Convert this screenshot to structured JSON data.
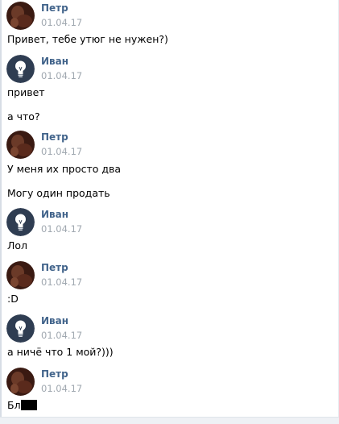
{
  "authors": {
    "petr": "Петр",
    "ivan": "Иван"
  },
  "messages": [
    {
      "author": "Петр",
      "avatar_icon": "user-photo-avatar",
      "date": "01.04.17",
      "lines": [
        "Привет, тебе утюг не нужен?)"
      ]
    },
    {
      "author": "Иван",
      "avatar_icon": "lightbulb-icon",
      "date": "01.04.17",
      "lines": [
        "привет",
        "а что?"
      ]
    },
    {
      "author": "Петр",
      "avatar_icon": "user-photo-avatar",
      "date": "01.04.17",
      "lines": [
        "У меня их просто два",
        "Могу один продать"
      ]
    },
    {
      "author": "Иван",
      "avatar_icon": "lightbulb-icon",
      "date": "01.04.17",
      "lines": [
        "Лол"
      ]
    },
    {
      "author": "Петр",
      "avatar_icon": "user-photo-avatar",
      "date": "01.04.17",
      "lines": [
        ":D"
      ]
    },
    {
      "author": "Иван",
      "avatar_icon": "lightbulb-icon",
      "date": "01.04.17",
      "lines": [
        "а ничё что 1 мой?)))"
      ]
    },
    {
      "author": "Петр",
      "avatar_icon": "user-photo-avatar",
      "date": "01.04.17",
      "lines": [
        "Бл"
      ]
    }
  ],
  "colors": {
    "author_link": "#42648b",
    "date": "#a0a8b0",
    "ivan_avatar_bg": "#2f3d52",
    "petr_avatar_bg": "#4a2418",
    "redaction": "#000000"
  }
}
